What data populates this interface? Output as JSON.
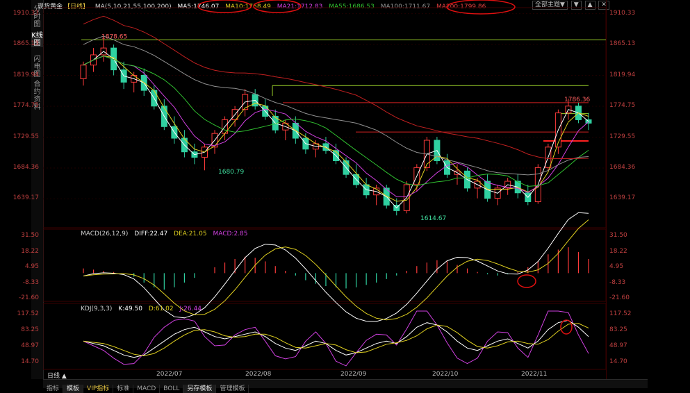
{
  "header": {
    "instrument": "现货黄金",
    "period_tag": "【日线】",
    "ma_params": "MA(5,10,21,55,100,200)",
    "ma5": "MA5:1746.07",
    "ma10": "MA10:1758.49",
    "ma21": "MA21:1712.83",
    "ma55": "MA55:1686.53",
    "ma100": "MA100:1711.67",
    "ma200": "MA200:1799.86"
  },
  "controls": {
    "main_theme": "全部主题▼",
    "down": "▼",
    "up": "▲",
    "close": "✕"
  },
  "left_tabs": [
    "分时图",
    "K线图",
    "闪电图",
    "合约资料"
  ],
  "price_axis": [
    "1910.33",
    "1865.13",
    "1819.94",
    "1774.75",
    "1729.55",
    "1684.36",
    "1639.17"
  ],
  "annotations": {
    "high1": "1878.65",
    "low1": "1680.79",
    "low2": "1614.67",
    "high2": "1786.36"
  },
  "macd": {
    "params": "MACD(26,12,9)",
    "diff": "DIFF:22.47",
    "dea": "DEA:21.05",
    "macd": "MACD:2.85",
    "axis": [
      "31.50",
      "18.22",
      "4.95",
      "-8.33",
      "-21.60"
    ]
  },
  "kdj": {
    "params": "KDJ(9,3,3)",
    "k": "K:49.50",
    "d": "D:61.02",
    "j": "J:26.44",
    "axis": [
      "117.52",
      "83.25",
      "48.97",
      "14.70"
    ]
  },
  "dates": [
    "2022/07",
    "2022/08",
    "2022/09",
    "2022/10",
    "2022/11"
  ],
  "mode_tag": "日线 ▲",
  "bottom_tabs": [
    "指标",
    "模板",
    "VIP指标",
    "标准",
    "MACD",
    "BOLL",
    "另存模板",
    "管理模板"
  ],
  "colors": {
    "up": "#ff3b3b",
    "down": "#2fd0a0",
    "ma5": "#ffffff",
    "ma10": "#e0d020",
    "ma21": "#d040e0",
    "ma55": "#30c030",
    "ma100": "#909090",
    "ma200": "#c02020"
  },
  "chart_data": {
    "type": "candlestick",
    "price_axis_range": [
      1600,
      1915
    ],
    "candles_ohlc_sampled": [
      [
        1815,
        1840,
        1805,
        1835
      ],
      [
        1835,
        1860,
        1825,
        1850
      ],
      [
        1850,
        1878,
        1840,
        1860
      ],
      [
        1860,
        1865,
        1820,
        1828
      ],
      [
        1828,
        1840,
        1800,
        1810
      ],
      [
        1810,
        1825,
        1795,
        1820
      ],
      [
        1820,
        1830,
        1790,
        1798
      ],
      [
        1798,
        1805,
        1770,
        1775
      ],
      [
        1775,
        1785,
        1740,
        1745
      ],
      [
        1745,
        1760,
        1720,
        1728
      ],
      [
        1728,
        1740,
        1700,
        1708
      ],
      [
        1708,
        1720,
        1690,
        1700
      ],
      [
        1700,
        1720,
        1681,
        1715
      ],
      [
        1715,
        1740,
        1705,
        1735
      ],
      [
        1735,
        1760,
        1725,
        1755
      ],
      [
        1755,
        1775,
        1745,
        1770
      ],
      [
        1770,
        1800,
        1760,
        1792
      ],
      [
        1792,
        1800,
        1770,
        1775
      ],
      [
        1775,
        1785,
        1755,
        1760
      ],
      [
        1760,
        1770,
        1735,
        1740
      ],
      [
        1740,
        1755,
        1725,
        1750
      ],
      [
        1750,
        1760,
        1720,
        1728
      ],
      [
        1728,
        1735,
        1705,
        1712
      ],
      [
        1712,
        1725,
        1700,
        1720
      ],
      [
        1720,
        1730,
        1705,
        1710
      ],
      [
        1710,
        1720,
        1690,
        1695
      ],
      [
        1695,
        1700,
        1670,
        1675
      ],
      [
        1675,
        1690,
        1655,
        1660
      ],
      [
        1660,
        1670,
        1640,
        1645
      ],
      [
        1645,
        1660,
        1630,
        1655
      ],
      [
        1655,
        1660,
        1625,
        1630
      ],
      [
        1630,
        1640,
        1615,
        1622
      ],
      [
        1622,
        1665,
        1618,
        1660
      ],
      [
        1660,
        1690,
        1650,
        1685
      ],
      [
        1685,
        1730,
        1680,
        1725
      ],
      [
        1725,
        1730,
        1690,
        1695
      ],
      [
        1695,
        1705,
        1670,
        1675
      ],
      [
        1675,
        1690,
        1660,
        1680
      ],
      [
        1680,
        1685,
        1650,
        1655
      ],
      [
        1655,
        1670,
        1640,
        1665
      ],
      [
        1665,
        1675,
        1635,
        1640
      ],
      [
        1640,
        1660,
        1630,
        1655
      ],
      [
        1655,
        1670,
        1645,
        1665
      ],
      [
        1665,
        1675,
        1640,
        1648
      ],
      [
        1648,
        1660,
        1630,
        1635
      ],
      [
        1635,
        1690,
        1632,
        1685
      ],
      [
        1685,
        1720,
        1680,
        1715
      ],
      [
        1715,
        1770,
        1705,
        1765
      ],
      [
        1765,
        1786,
        1755,
        1775
      ],
      [
        1775,
        1780,
        1750,
        1755
      ],
      [
        1755,
        1765,
        1740,
        1750
      ]
    ],
    "macd_hist_sampled": [
      4,
      3,
      2,
      1,
      0,
      -3,
      -8,
      -12,
      -14,
      -12,
      -8,
      -4,
      0,
      5,
      9,
      12,
      14,
      13,
      10,
      6,
      2,
      -2,
      -6,
      -9,
      -11,
      -12,
      -13,
      -12,
      -10,
      -8,
      -5,
      -2,
      2,
      6,
      9,
      11,
      10,
      7,
      4,
      1,
      -1,
      -2,
      -1,
      1,
      5,
      10,
      16,
      20,
      22,
      18,
      12
    ],
    "kdj_k_sampled": [
      60,
      55,
      50,
      40,
      30,
      25,
      30,
      45,
      60,
      75,
      85,
      90,
      80,
      70,
      65,
      70,
      75,
      80,
      70,
      55,
      45,
      40,
      50,
      60,
      55,
      40,
      30,
      35,
      45,
      55,
      60,
      55,
      70,
      90,
      100,
      95,
      80,
      60,
      45,
      40,
      50,
      60,
      65,
      55,
      45,
      60,
      85,
      100,
      105,
      90,
      70
    ]
  }
}
